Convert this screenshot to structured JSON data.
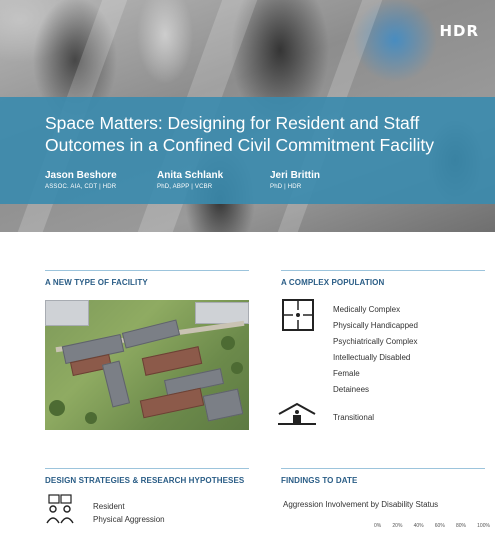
{
  "logo": "HDR",
  "title": "Space Matters: Designing for Resident and Staff Outcomes in a Confined Civil Commitment Facility",
  "authors": [
    {
      "name": "Jason Beshore",
      "credentials": "ASSOC. AIA, CDT | HDR"
    },
    {
      "name": "Anita Schlank",
      "credentials": "PhD, ABPP | VCBR"
    },
    {
      "name": "Jeri Brittin",
      "credentials": "PhD | HDR"
    }
  ],
  "sections": {
    "facility": "A NEW TYPE OF FACILITY",
    "population": "A COMPLEX POPULATION",
    "strategies": "DESIGN STRATEGIES & RESEARCH HYPOTHESES",
    "findings": "FINDINGS TO DATE"
  },
  "population": {
    "items": [
      "Medically Complex",
      "Physically Handicapped",
      "Psychiatrically Complex",
      "Intellectually Disabled",
      "Female",
      "Detainees"
    ],
    "transitional": "Transitional",
    "icons": [
      "grid-plan-icon",
      "house-icon"
    ]
  },
  "strategies": {
    "lines": [
      "Resident",
      "Physical Aggression"
    ],
    "icon": "people-conflict-icon"
  },
  "findings": {
    "subtitle": "Aggression Involvement by Disability Status",
    "axis_ticks": [
      "0%",
      "20%",
      "40%",
      "60%",
      "80%",
      "100%"
    ]
  },
  "colors": {
    "accent_band": "#3a8bae",
    "heading": "#2a5d86",
    "rule": "#9cc4dc"
  }
}
